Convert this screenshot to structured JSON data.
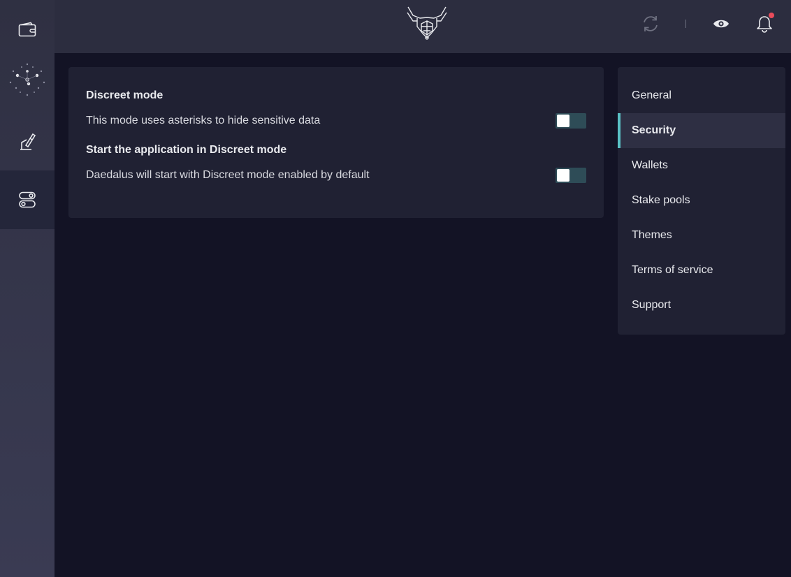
{
  "sidebar": {
    "items": [
      {
        "icon": "wallet-icon"
      },
      {
        "icon": "stake-pools-icon"
      },
      {
        "icon": "voting-icon"
      },
      {
        "icon": "settings-toggle-icon"
      }
    ],
    "active_index": 3
  },
  "topbar": {
    "logo": "daedalus-logo-icon",
    "icons": [
      "sync-icon",
      "eye-icon",
      "bell-icon"
    ],
    "notification_dot_color": "#ea4c5b"
  },
  "security": {
    "discreet_mode": {
      "title": "Discreet mode",
      "description": "This mode uses asterisks to hide sensitive data",
      "enabled": false
    },
    "start_in_discreet": {
      "title": "Start the application in Discreet mode",
      "description": "Daedalus will start with Discreet mode enabled by default",
      "enabled": false
    }
  },
  "menu": {
    "items": [
      {
        "label": "General"
      },
      {
        "label": "Security"
      },
      {
        "label": "Wallets"
      },
      {
        "label": "Stake pools"
      },
      {
        "label": "Themes"
      },
      {
        "label": "Terms of service"
      },
      {
        "label": "Support"
      }
    ],
    "active": "Security",
    "accent_color": "#5ac2c6"
  }
}
